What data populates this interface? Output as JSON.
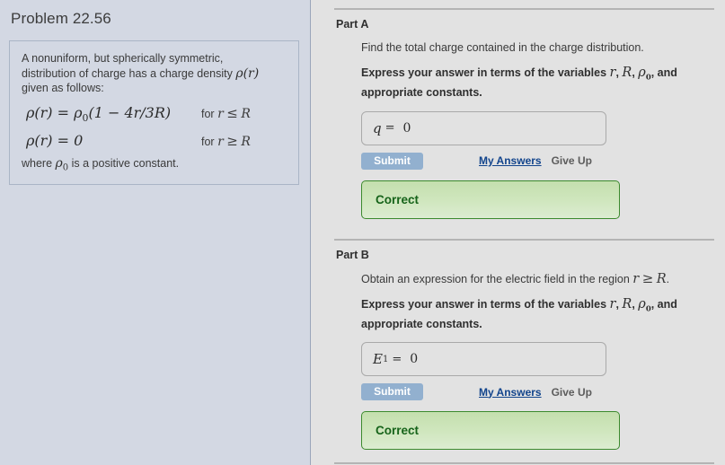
{
  "problem": {
    "title": "Problem 22.56",
    "intro_line1": "A nonuniform, but spherically symmetric,",
    "intro_line2_pre": "distribution of charge has a charge density ",
    "intro_line2_math": "ρ(r)",
    "intro_line3": "given as follows:",
    "equations": [
      {
        "lhs_rho": "ρ(r) = ρ",
        "lhs_sub": "0",
        "lhs_rest": "(1 − 4r/3R)",
        "cond_prefix": "for ",
        "cond_var": "r",
        "cond_op": "≤",
        "cond_bound": "R"
      },
      {
        "lhs_rho": "ρ(r) = 0",
        "lhs_sub": "",
        "lhs_rest": "",
        "cond_prefix": "for ",
        "cond_var": "r",
        "cond_op": "≥",
        "cond_bound": "R"
      }
    ],
    "where_pre": "where ",
    "where_rho": "ρ",
    "where_sub": "0",
    "where_post": " is a positive constant."
  },
  "parts": [
    {
      "label": "Part A",
      "question_pre": "Find the total charge contained in the charge distribution.",
      "question_var": "",
      "question_op": "",
      "question_bound": "",
      "question_post": "",
      "instruction_pre": "Express your answer in terms of the variables ",
      "instruction_v1": "r",
      "instruction_sep1": ", ",
      "instruction_v2": "R",
      "instruction_sep2": ", ",
      "instruction_v3": "ρ",
      "instruction_v3_sub": "0",
      "instruction_post": ", and appropriate constants.",
      "answer_label": "q",
      "answer_label_sub": "",
      "answer_equals": "=",
      "answer_value": "0",
      "submit_label": "Submit",
      "my_answers_label": "My Answers",
      "give_up_label": "Give Up",
      "feedback": "Correct"
    },
    {
      "label": "Part B",
      "question_pre": "Obtain an expression for the electric field in the region ",
      "question_var": "r",
      "question_op": "≥",
      "question_bound": "R",
      "question_post": ".",
      "instruction_pre": "Express your answer in terms of the variables ",
      "instruction_v1": "r",
      "instruction_sep1": ", ",
      "instruction_v2": "R",
      "instruction_sep2": ", ",
      "instruction_v3": "ρ",
      "instruction_v3_sub": "0",
      "instruction_post": ", and appropriate constants.",
      "answer_label": "E",
      "answer_label_sub": "1",
      "answer_equals": "=",
      "answer_value": "0",
      "submit_label": "Submit",
      "my_answers_label": "My Answers",
      "give_up_label": "Give Up",
      "feedback": "Correct"
    }
  ],
  "colors": {
    "left_panel_bg": "#d3d8e3",
    "right_panel_bg": "#e2e2e2",
    "submit_bg": "#92b0cf",
    "link_blue": "#12448c",
    "correct_border": "#3c8a2e",
    "correct_text": "#16631a"
  }
}
